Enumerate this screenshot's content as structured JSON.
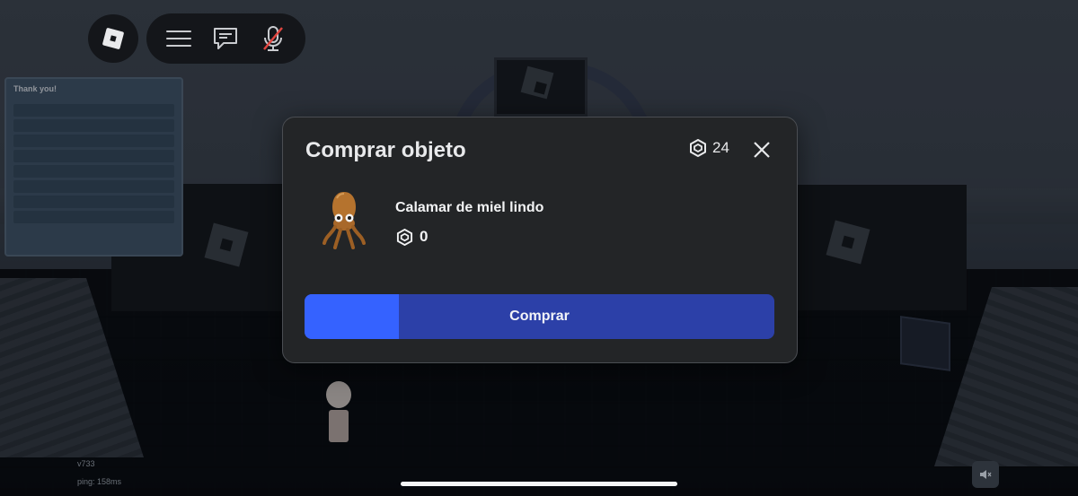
{
  "topbar": {
    "logo_icon": "roblox-logo-icon",
    "menu_icon": "hamburger-menu-icon",
    "chat_icon": "chat-icon",
    "mic_icon": "mic-muted-icon"
  },
  "modal": {
    "title": "Comprar objeto",
    "balance": "24",
    "currency_icon": "robux-icon",
    "close_icon": "close-icon",
    "item": {
      "name": "Calamar de miel lindo",
      "price": "0",
      "image_icon": "honey-squid-icon"
    },
    "buy_button": {
      "label": "Comprar",
      "progress": 0.2
    }
  },
  "background": {
    "leaderboard_title": "Thank you!",
    "version": "v733",
    "ping": "ping: 158ms"
  },
  "colors": {
    "modal_bg": "#232527",
    "button_bg": "#2c40a8",
    "button_fill": "#3562ff"
  }
}
